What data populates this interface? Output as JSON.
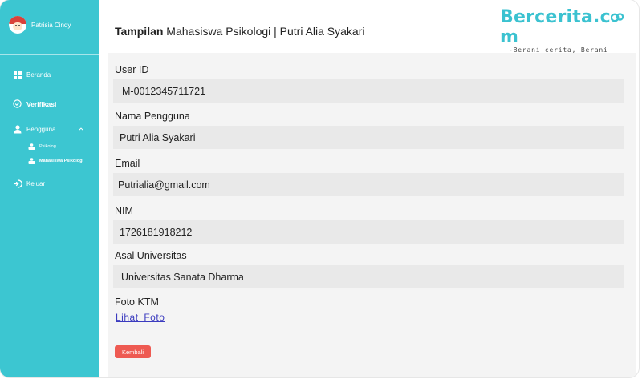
{
  "sidebar": {
    "profile_name": "Patrisia Cindy",
    "items": [
      {
        "label": "Beranda",
        "icon": "grid-icon"
      },
      {
        "label": "Verifikasi",
        "icon": "check-circle-icon"
      },
      {
        "label": "Pengguna",
        "icon": "user-icon"
      },
      {
        "label": "Keluar",
        "icon": "logout-icon"
      }
    ],
    "sub_items": [
      {
        "label": "Psikolog",
        "icon": "user-badge-icon"
      },
      {
        "label": "Mahasiswa Psikologi",
        "icon": "user-badge-icon"
      }
    ],
    "bg_color": "#3cc6d1"
  },
  "header": {
    "title_bold": "Tampilan",
    "title_rest": " Mahasiswa Psikologi | Putri Alia Syakari",
    "brand_name": "Bercerita.c",
    "brand_name_end": "m",
    "brand_tagline": "-Berani cerita, Berani pulih-",
    "brand_color": "#3bc2d0"
  },
  "form": {
    "fields": [
      {
        "label": "User ID",
        "value": "M-0012345711721"
      },
      {
        "label": "Nama Pengguna",
        "value": "Putri Alia Syakari"
      },
      {
        "label": "Email",
        "value": "Putrialia@gmail.com"
      },
      {
        "label": "NIM",
        "value": "1726181918212"
      },
      {
        "label": "Asal Universitas",
        "value": "Universitas Sanata Dharma"
      }
    ],
    "photo_label": "Foto KTM",
    "photo_link": "Lihat Foto",
    "back_button": "Kembali",
    "back_color": "#ee5a52"
  }
}
